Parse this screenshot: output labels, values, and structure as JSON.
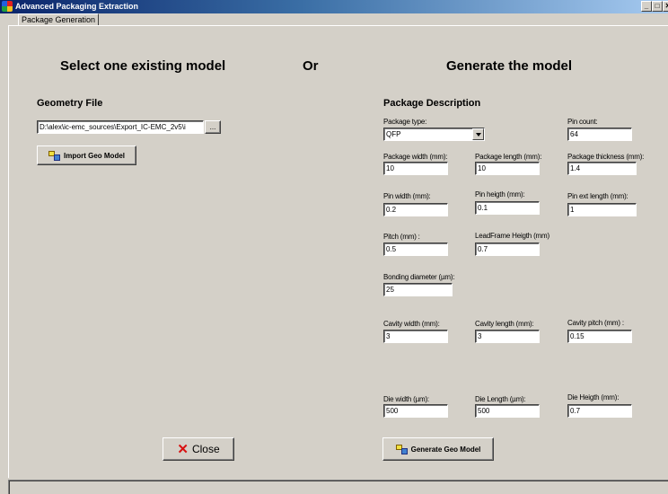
{
  "window": {
    "title": "Advanced Packaging Extraction",
    "minimize_glyph": "_",
    "maximize_glyph": "□",
    "close_glyph": "✕"
  },
  "tab": {
    "label": "Package Generation"
  },
  "left": {
    "heading": "Select one existing model",
    "geometry_label": "Geometry File",
    "geometry_path": "D:\\alex\\ic-emc_sources\\Export_IC-EMC_2v5\\i",
    "browse_label": "...",
    "import_button": "Import Geo Model"
  },
  "or_label": "Or",
  "right": {
    "heading": "Generate the model",
    "description_label": "Package Description",
    "fields": {
      "package_type": {
        "label": "Package type:",
        "value": "QFP"
      },
      "pin_count": {
        "label": "Pin count:",
        "value": "64"
      },
      "package_width": {
        "label": "Package width (mm):",
        "value": "10"
      },
      "package_length": {
        "label": "Package length (mm):",
        "value": "10"
      },
      "package_thickness": {
        "label": "Package thickness (mm):",
        "value": "1.4"
      },
      "pin_width": {
        "label": "Pin width (mm):",
        "value": "0.2"
      },
      "pin_height": {
        "label": "Pin heigth (mm):",
        "value": "0.1"
      },
      "pin_ext_length": {
        "label": "Pin ext length (mm):",
        "value": "1"
      },
      "pitch": {
        "label": "Pitch (mm) :",
        "value": "0.5"
      },
      "leadframe_height": {
        "label": "LeadFrame Heigth (mm)",
        "value": "0.7"
      },
      "bonding_diameter": {
        "label": "Bonding diameter (µm):",
        "value": "25"
      },
      "cavity_width": {
        "label": "Cavity width (mm):",
        "value": "3"
      },
      "cavity_length": {
        "label": "Cavity length (mm):",
        "value": "3"
      },
      "cavity_pitch": {
        "label": "Cavity pitch (mm) :",
        "value": "0.15"
      },
      "die_width": {
        "label": "Die width (µm):",
        "value": "500"
      },
      "die_length": {
        "label": "Die Length (µm):",
        "value": "500"
      },
      "die_height": {
        "label": "Die Heigth (mm):",
        "value": "0.7"
      }
    },
    "generate_button": "Generate Geo Model"
  },
  "close_button": "Close"
}
